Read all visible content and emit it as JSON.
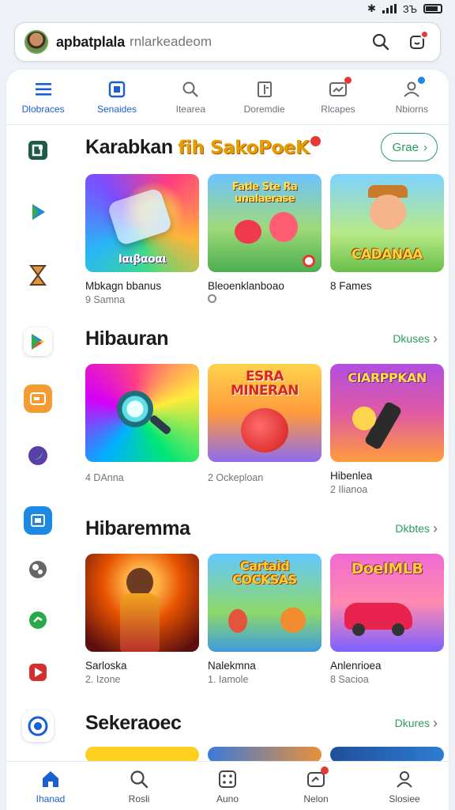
{
  "status_bar": {
    "signal_text": "ᛞ",
    "battery_text": "ЗЪ"
  },
  "search": {
    "title": "apbatplala",
    "placeholder": "rnlarkeadeom"
  },
  "top_tabs": [
    {
      "label": "Dlobraces",
      "icon": "menu-icon",
      "active": true
    },
    {
      "label": "Senaides",
      "icon": "grid-icon",
      "active": false
    },
    {
      "label": "Itearea",
      "icon": "search-icon",
      "active": false
    },
    {
      "label": "Doremdie",
      "icon": "book-icon",
      "active": false
    },
    {
      "label": "Rlcapes",
      "icon": "notification-icon",
      "active": false,
      "badge": true
    },
    {
      "label": "Nbiorns",
      "icon": "person-icon",
      "active": false,
      "badge": true
    }
  ],
  "sections": [
    {
      "title_prefix": "Karabkan",
      "title_highlight": "fih SakoPoeK",
      "button_label": "Grae",
      "cards": [
        {
          "name": "Mbkagn bbanus",
          "meta": "9 Samna",
          "art_text": "Ιαιβαοαι"
        },
        {
          "name": "Bleoenklanboao",
          "meta": "",
          "art_text": "Fatle Ste Ra unalaerase"
        },
        {
          "name": "8 Fames",
          "meta": "",
          "art_text": "CADANAA"
        }
      ]
    },
    {
      "title": "Hibauran",
      "more_label": "Dkuses",
      "cards": [
        {
          "name": "",
          "meta": "4 DAnna",
          "art_text": ""
        },
        {
          "name": "",
          "meta": "2 Ockeploan",
          "art_text": "ESRA MINERAN"
        },
        {
          "name": "Hibenlea",
          "meta": "2 Ilianoa",
          "art_text": "CIARPPKAN"
        }
      ]
    },
    {
      "title": "Hibaremma",
      "more_label": "Dkbtes",
      "cards": [
        {
          "name": "Sarloska",
          "meta": "2. Izone",
          "art_text": ""
        },
        {
          "name": "Nalekmna",
          "meta": "1. Iamole",
          "art_text": "Cartaid COCKSAS"
        },
        {
          "name": "Anlenrioea",
          "meta": "8 Sacioa",
          "art_text": "DoeIMLB"
        }
      ]
    },
    {
      "title": "Sekeraoec",
      "more_label": "Dkures"
    }
  ],
  "bottom_nav": [
    {
      "label": "Ihanad",
      "icon": "home-icon",
      "active": true
    },
    {
      "label": "Rosli",
      "icon": "search-icon",
      "active": false
    },
    {
      "label": "Auno",
      "icon": "dice-icon",
      "active": false
    },
    {
      "label": "Nelon",
      "icon": "notification-icon",
      "active": false,
      "badge": true
    },
    {
      "label": "Slosiee",
      "icon": "profile-icon",
      "active": false
    }
  ],
  "colors": {
    "accent": "#1a5fd0",
    "green_link": "#2a9d5c",
    "badge": "#e53935"
  }
}
